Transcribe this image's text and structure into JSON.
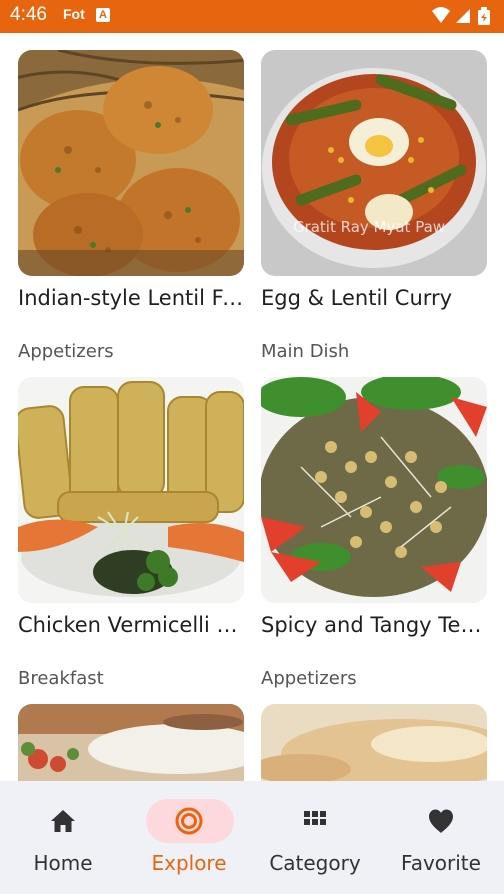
{
  "status_bar": {
    "time": "4:46",
    "notification_text": "Fot",
    "notification_badge": "A",
    "background_color": "#E8650F",
    "icons": [
      "wifi-icon",
      "signal-icon",
      "battery-icon"
    ]
  },
  "recipes": [
    {
      "title": "Indian-style Lentil Fritters",
      "category": "Appetizers"
    },
    {
      "title": "Egg & Lentil Curry",
      "category": "Main Dish"
    },
    {
      "title": "Chicken Vermicelli Spring Rolls",
      "category": "Breakfast"
    },
    {
      "title": "Spicy and Tangy Tea Leaf Salad",
      "category": "Appetizers"
    }
  ],
  "photo_watermark": "Gratit Ray Myat Paw",
  "bottom_nav": {
    "active_color": "#E8650F",
    "active_pill_color": "#FDD9DD",
    "items": [
      {
        "label": "Home",
        "icon": "home-icon"
      },
      {
        "label": "Explore",
        "icon": "explore-icon",
        "active": true
      },
      {
        "label": "Category",
        "icon": "grid-icon"
      },
      {
        "label": "Favorite",
        "icon": "heart-icon"
      }
    ]
  }
}
